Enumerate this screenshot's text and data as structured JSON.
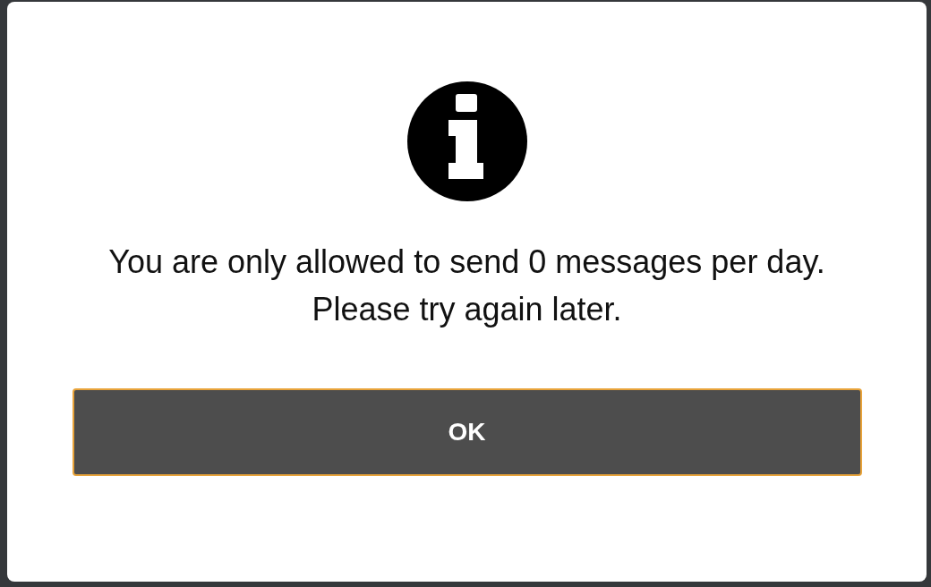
{
  "dialog": {
    "message": "You are only allowed to send 0 messages per day. Please try again later.",
    "button": {
      "label": "OK",
      "focused": true
    }
  }
}
